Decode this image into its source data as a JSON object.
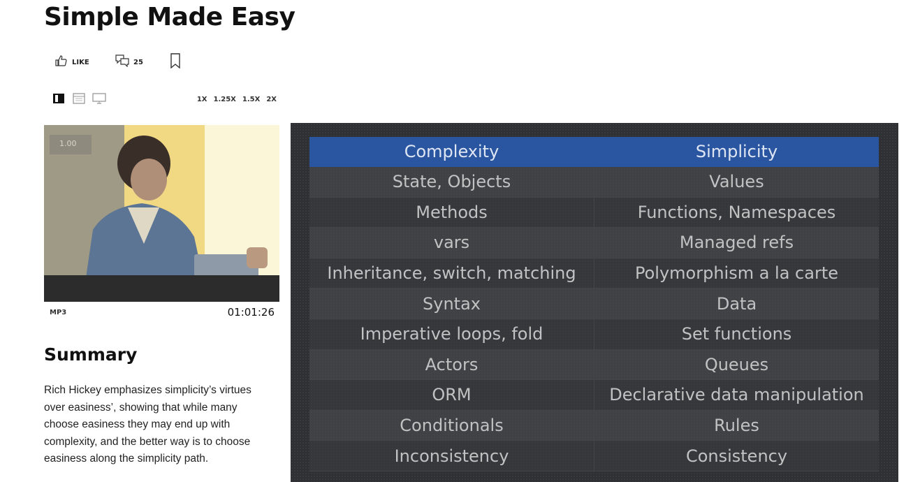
{
  "page": {
    "title": "Simple Made Easy"
  },
  "actions": {
    "like_label": "LIKE",
    "comments_count": "25"
  },
  "speeds": [
    "1X",
    "1.25X",
    "1.5X",
    "2X"
  ],
  "media": {
    "audio_label": "MP3",
    "duration": "01:01:26",
    "player_sign": "1.00"
  },
  "summary": {
    "heading": "Summary",
    "text": "Rich Hickey emphasizes simplicity’s virtues over easiness’, showing that while many choose easiness they may end up with complexity, and the better way is to choose easiness along the simplicity path."
  },
  "slide": {
    "headers": [
      "Complexity",
      "Simplicity"
    ],
    "rows": [
      [
        "State, Objects",
        "Values"
      ],
      [
        "Methods",
        "Functions, Namespaces"
      ],
      [
        "vars",
        "Managed refs"
      ],
      [
        "Inheritance, switch, matching",
        "Polymorphism a la carte"
      ],
      [
        "Syntax",
        "Data"
      ],
      [
        "Imperative loops, fold",
        "Set functions"
      ],
      [
        "Actors",
        "Queues"
      ],
      [
        "ORM",
        "Declarative data manipulation"
      ],
      [
        "Conditionals",
        "Rules"
      ],
      [
        "Inconsistency",
        "Consistency"
      ]
    ]
  }
}
